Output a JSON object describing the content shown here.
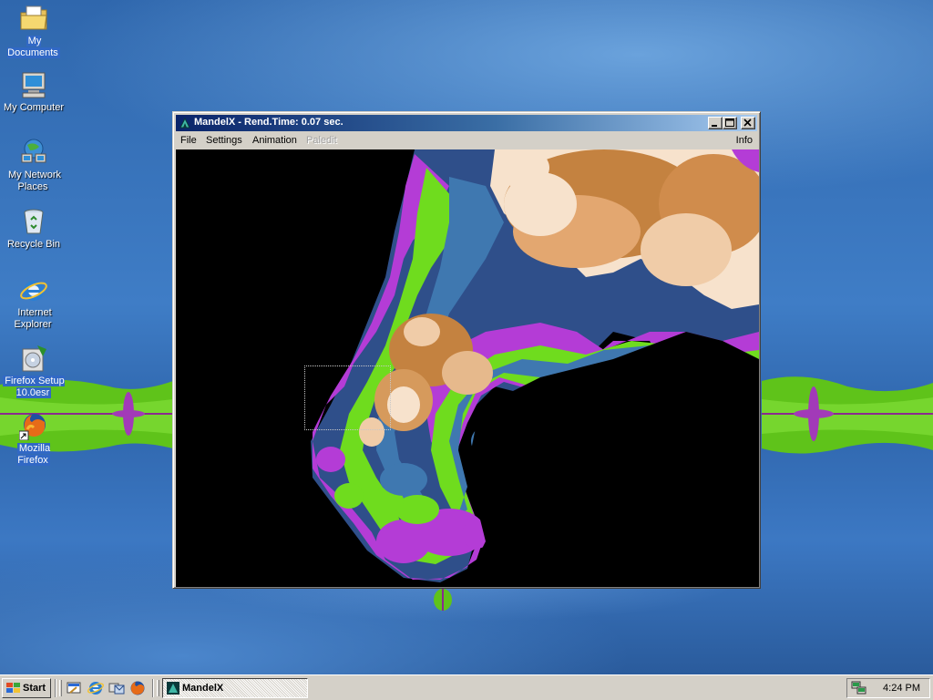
{
  "desktop": {
    "icons": [
      {
        "label": "My Documents",
        "icon": "folder-documents-icon",
        "selected": true
      },
      {
        "label": "My Computer",
        "icon": "computer-icon"
      },
      {
        "label": "My Network\nPlaces",
        "icon": "network-places-icon"
      },
      {
        "label": "Recycle Bin",
        "icon": "recycle-bin-icon"
      },
      {
        "label": "Internet\nExplorer",
        "icon": "internet-explorer-icon"
      },
      {
        "label": "Firefox Setup\n10.0esr",
        "icon": "installer-icon",
        "selected": true
      },
      {
        "label": "Mozilla Firefox",
        "icon": "firefox-icon",
        "selected": true
      }
    ]
  },
  "window": {
    "title": "MandelX - Rend.Time:  0.07 sec.",
    "controls": [
      "minimize",
      "maximize",
      "close"
    ],
    "menu": {
      "file": "File",
      "settings": "Settings",
      "animation": "Animation",
      "paledit": "Paledit",
      "info": "Info"
    }
  },
  "taskbar": {
    "start_label": "Start",
    "quick_launch": [
      "show-desktop-icon",
      "internet-explorer-icon",
      "outlook-icon",
      "firefox-icon"
    ],
    "task_label": "MandelX",
    "clock": "4:24 PM"
  },
  "colors": {
    "titlebar_start": "#0a246a",
    "titlebar_end": "#a6caf0",
    "fractal_green": "#6fdc1e",
    "fractal_purple": "#b43cd6",
    "fractal_orange": "#c48240",
    "fractal_peach": "#f7e2cc",
    "fractal_blue": "#3f78b0"
  }
}
